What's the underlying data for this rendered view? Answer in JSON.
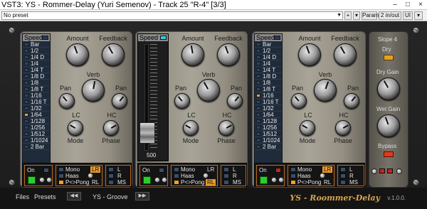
{
  "window": {
    "title": "VST3: YS - Rommer-Delay (Yuri Semenov) - Track 25 \"R-4\" [3/3]",
    "minimize": "–",
    "maximize": "□",
    "close": "×"
  },
  "toolbar": {
    "preset": "No preset",
    "plus": "+",
    "param": "Param",
    "io": "2 in/out",
    "ui": "UI"
  },
  "delay_units": [
    {
      "speed_label": "Speed",
      "speeds": [
        "Bar",
        "1/2",
        "1/4 D",
        "1/4",
        "1/4 T",
        "1/8 D",
        "1/8",
        "1/8 T",
        "1/16",
        "1/16 T",
        "1/32",
        "1/64",
        "1/128",
        "1/256",
        "1/512",
        "1/1024",
        "2 Bar"
      ],
      "selected": "1/64",
      "knobs": {
        "amount": "Amount",
        "feedback": "Feedback",
        "verb": "Verb",
        "pan_l": "Pan",
        "pan_r": "Pan",
        "lc": "LC",
        "hc": "HC",
        "mode": "Mode",
        "phase": "Phase"
      },
      "bottom": {
        "on": "On",
        "mono": "Mono",
        "haas": "Haas",
        "pong": "P<>Pong",
        "lr": "LR",
        "rl": "RL",
        "l": "L",
        "r": "R",
        "ms": "MS"
      }
    },
    {
      "speed_label": "Speed",
      "fader_value": "500",
      "knobs": {
        "amount": "Amount",
        "feedback": "Feedback",
        "verb": "Verb",
        "pan_l": "Pan",
        "pan_r": "Pan",
        "lc": "LC",
        "hc": "HC",
        "mode": "Mode",
        "phase": "Phase"
      },
      "bottom": {
        "on": "On",
        "mono": "Mono",
        "haas": "Haas",
        "pong": "P<>Pong",
        "lr": "LR",
        "rl": "RL",
        "l": "L",
        "r": "R",
        "ms": "MS"
      }
    },
    {
      "speed_label": "Speed",
      "speeds": [
        "Bar",
        "1/2",
        "1/4 D",
        "1/4",
        "1/4 T",
        "1/8 D",
        "1/8",
        "1/8 T",
        "1/16",
        "1/16 T",
        "1/32",
        "1/64",
        "1/128",
        "1/256",
        "1/512",
        "1/1024",
        "2 Bar"
      ],
      "selected": "1/16",
      "knobs": {
        "amount": "Amount",
        "feedback": "Feedback",
        "verb": "Verb",
        "pan_l": "Pan",
        "pan_r": "Pan",
        "lc": "LC",
        "hc": "HC",
        "mode": "Mode",
        "phase": "Phase"
      },
      "bottom": {
        "on": "On",
        "mono": "Mono",
        "haas": "Haas",
        "pong": "P<>Pong",
        "lr": "LR",
        "rl": "RL",
        "l": "L",
        "r": "R",
        "ms": "MS"
      }
    }
  ],
  "master": {
    "slope": "Slope  4",
    "dry": "Dry",
    "dry_gain": "Dry Gain",
    "wet_gain": "Wet Gain",
    "bypass": "Bypass"
  },
  "footer": {
    "files": "Files",
    "presets": "Presets",
    "prev": "◀◀",
    "next": "▶▶",
    "preset_name": "YS - Groove",
    "brand": "YS - Roommer-Delay",
    "version": "v.1.0.0."
  },
  "colors": {
    "accent": "#f0a020",
    "list_bg": "#1f2b3a",
    "on_led": "#29d02c",
    "panel": "#a9a498"
  }
}
